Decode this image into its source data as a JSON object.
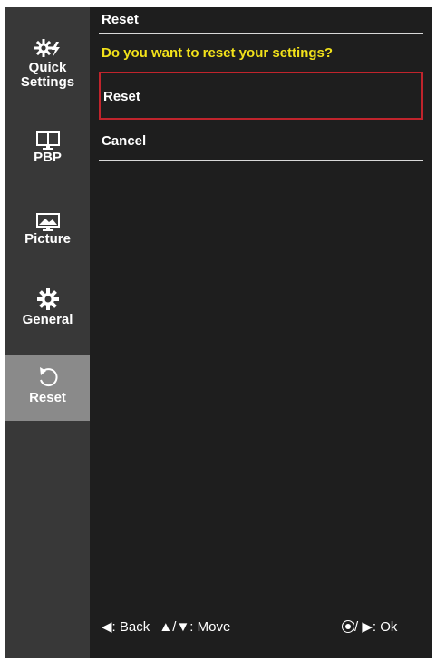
{
  "sidebar": {
    "items": [
      {
        "label_line1": "Quick",
        "label_line2": "Settings",
        "icon": "quick-settings-gear-bolt-icon"
      },
      {
        "label": "PBP",
        "icon": "pbp-monitor-icon"
      },
      {
        "label": "Picture",
        "icon": "picture-monitor-icon"
      },
      {
        "label": "General",
        "icon": "gear-icon"
      },
      {
        "label": "Reset",
        "icon": "reset-arrow-icon"
      }
    ],
    "active_item": "Reset"
  },
  "main": {
    "title": "Reset",
    "question": "Do you want to reset your settings?",
    "options": [
      {
        "label": "Reset",
        "selected": true
      },
      {
        "label": "Cancel",
        "selected": false
      }
    ]
  },
  "footer": {
    "back_text": ": Back",
    "move_text": ": Move",
    "ok_separator": "/",
    "ok_text": ": Ok"
  },
  "colors": {
    "background": "#1e1e1e",
    "sidebar": "#383838",
    "active_item": "#8a8a8a",
    "question_text": "#f2e21a",
    "selection_border": "#c0242c"
  }
}
